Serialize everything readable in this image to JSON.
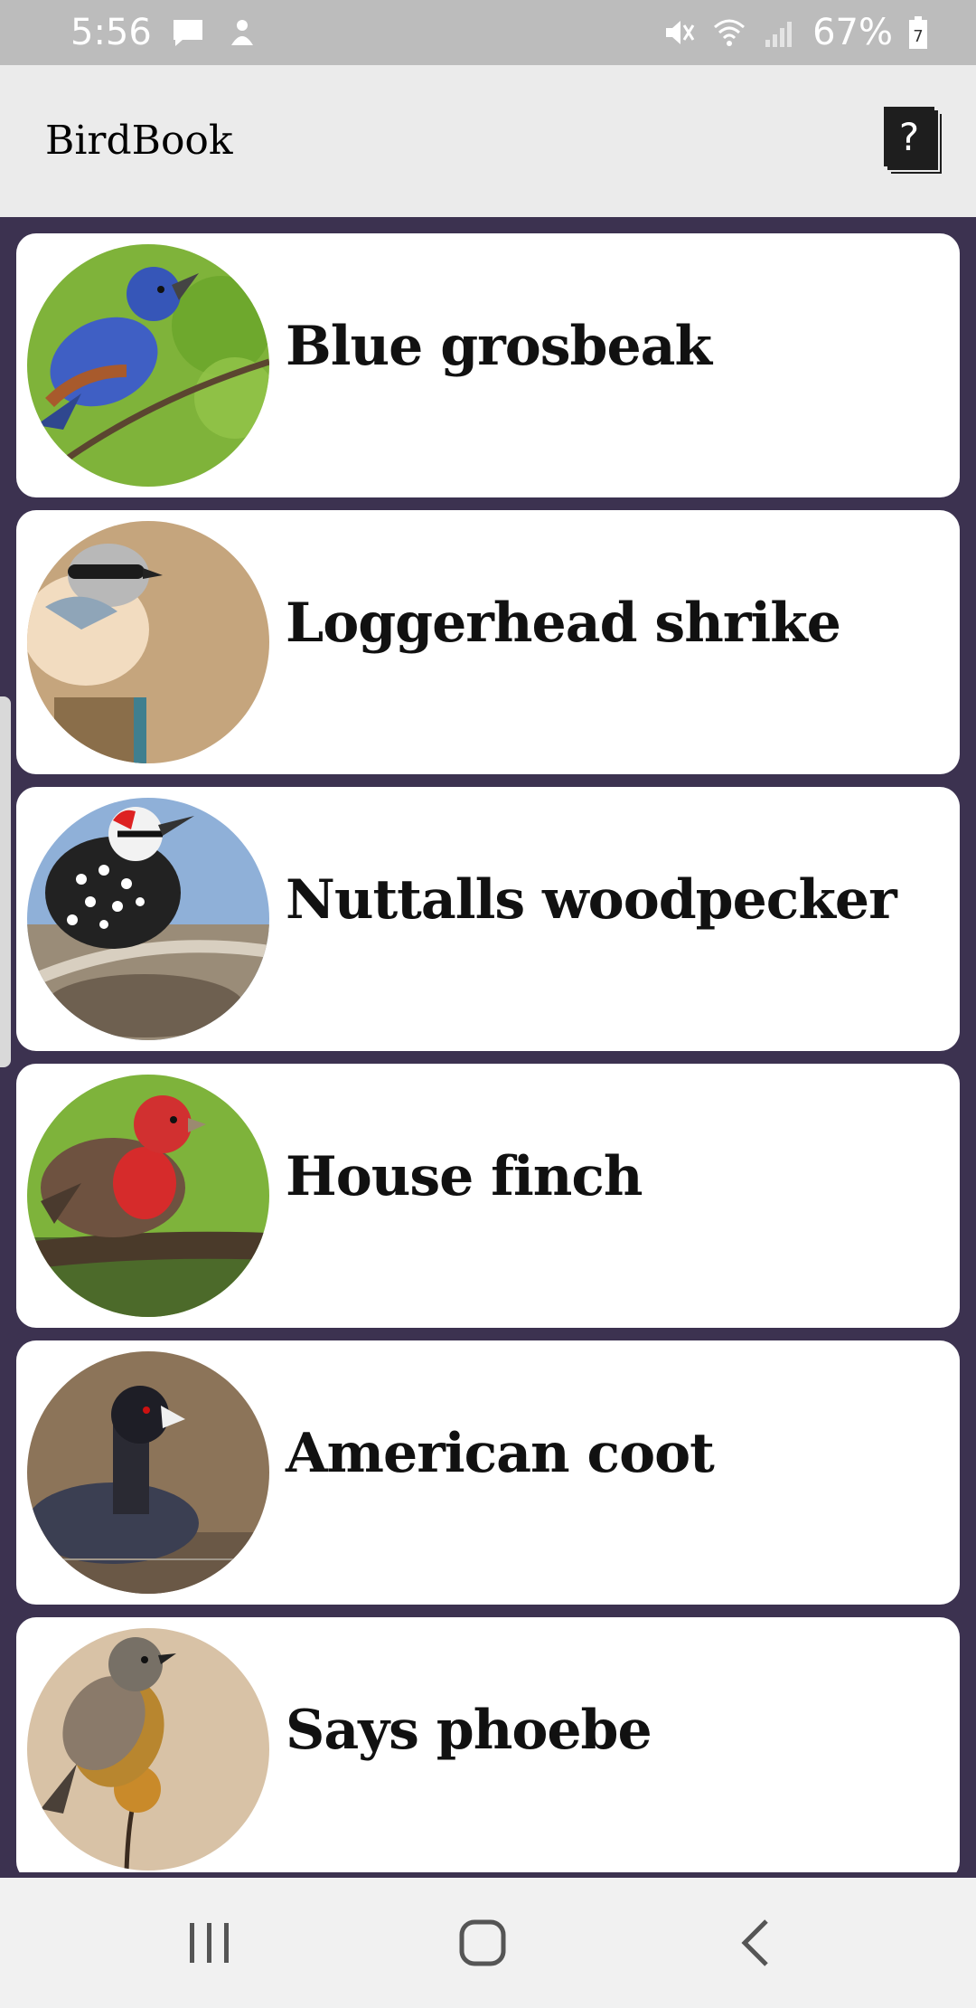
{
  "status_bar": {
    "time": "5:56",
    "battery": "67%",
    "left_icons": [
      "message-icon",
      "notification-icon"
    ],
    "right_icons": [
      "mute-icon",
      "wifi-icon",
      "signal-icon",
      "battery-icon"
    ]
  },
  "app_bar": {
    "title": "BirdBook",
    "help_label": "?"
  },
  "birds": [
    {
      "name": "Blue grosbeak",
      "photo": "blue-grosbeak-photo"
    },
    {
      "name": "Loggerhead shrike",
      "photo": "loggerhead-shrike-photo"
    },
    {
      "name": "Nuttalls woodpecker",
      "photo": "nuttalls-woodpecker-photo"
    },
    {
      "name": "House finch",
      "photo": "house-finch-photo"
    },
    {
      "name": "American coot",
      "photo": "american-coot-photo"
    },
    {
      "name": "Says phoebe",
      "photo": "says-phoebe-photo"
    }
  ],
  "colors": {
    "list_background": "#3c3250",
    "card_background": "#ffffff",
    "app_bar_background": "#ebebeb",
    "status_bar_background": "#bcbcbc"
  },
  "nav_bar": {
    "icons": [
      "recent-apps-icon",
      "home-icon",
      "back-icon"
    ]
  }
}
